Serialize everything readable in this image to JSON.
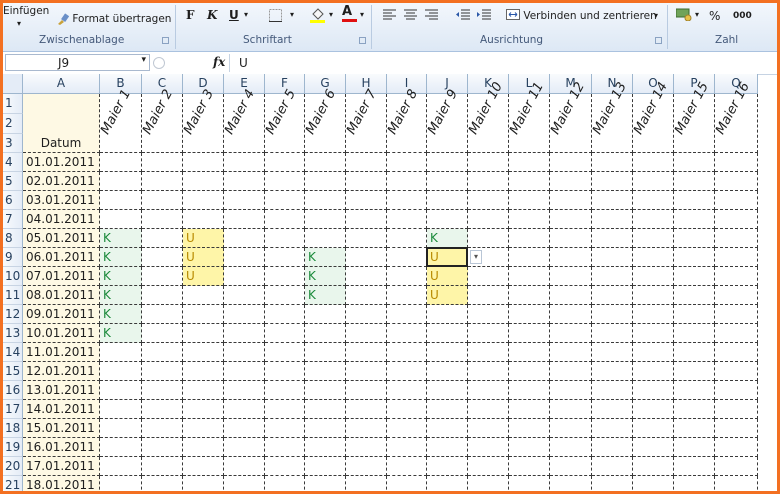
{
  "ribbon": {
    "paste_label": "Einfügen",
    "format_painter_label": "Format übertragen",
    "bold_label": "F",
    "italic_label": "K",
    "underline_label": "U",
    "font_color_letter": "A",
    "merge_label": "Verbinden und zentrieren",
    "percent_label": "%",
    "thousands_label": "000",
    "groups": [
      "Zwischenablage",
      "Schriftart",
      "Ausrichtung",
      "Zahl"
    ]
  },
  "formula_bar": {
    "name_box": "J9",
    "fx_label": "fx",
    "value": "U"
  },
  "grid": {
    "columns": [
      "A",
      "B",
      "C",
      "D",
      "E",
      "F",
      "G",
      "H",
      "I",
      "J",
      "K",
      "L",
      "M",
      "N",
      "O",
      "P",
      "Q"
    ],
    "header_rows": [
      "1",
      "2",
      "3"
    ],
    "date_header": "Datum",
    "employees": [
      "Maier 1",
      "Maier 2",
      "Maier 3",
      "Maier 4",
      "Maier 5",
      "Maier 6",
      "Maier 7",
      "Maier 8",
      "Maier 9",
      "Maier 10",
      "Maier 11",
      "Maier 12",
      "Maier 13",
      "Maier 14",
      "Maier 15",
      "Maier 16"
    ],
    "rows": [
      {
        "num": "4",
        "date": "01.01.2011",
        "cells": [
          "",
          "",
          "",
          "",
          "",
          "",
          "",
          "",
          "",
          "",
          "",
          "",
          "",
          "",
          "",
          ""
        ]
      },
      {
        "num": "5",
        "date": "02.01.2011",
        "cells": [
          "",
          "",
          "",
          "",
          "",
          "",
          "",
          "",
          "",
          "",
          "",
          "",
          "",
          "",
          "",
          ""
        ]
      },
      {
        "num": "6",
        "date": "03.01.2011",
        "cells": [
          "",
          "",
          "",
          "",
          "",
          "",
          "",
          "",
          "",
          "",
          "",
          "",
          "",
          "",
          "",
          ""
        ]
      },
      {
        "num": "7",
        "date": "04.01.2011",
        "cells": [
          "",
          "",
          "",
          "",
          "",
          "",
          "",
          "",
          "",
          "",
          "",
          "",
          "",
          "",
          "",
          ""
        ]
      },
      {
        "num": "8",
        "date": "05.01.2011",
        "cells": [
          "K",
          "",
          "U",
          "",
          "",
          "",
          "",
          "",
          "K",
          "",
          "",
          "",
          "",
          "",
          "",
          ""
        ]
      },
      {
        "num": "9",
        "date": "06.01.2011",
        "cells": [
          "K",
          "",
          "U",
          "",
          "",
          "K",
          "",
          "",
          "U",
          "",
          "",
          "",
          "",
          "",
          "",
          ""
        ]
      },
      {
        "num": "10",
        "date": "07.01.2011",
        "cells": [
          "K",
          "",
          "U",
          "",
          "",
          "K",
          "",
          "",
          "U",
          "",
          "",
          "",
          "",
          "",
          "",
          ""
        ]
      },
      {
        "num": "11",
        "date": "08.01.2011",
        "cells": [
          "K",
          "",
          "",
          "",
          "",
          "K",
          "",
          "",
          "U",
          "",
          "",
          "",
          "",
          "",
          "",
          ""
        ]
      },
      {
        "num": "12",
        "date": "09.01.2011",
        "cells": [
          "K",
          "",
          "",
          "",
          "",
          "",
          "",
          "",
          "",
          "",
          "",
          "",
          "",
          "",
          "",
          ""
        ]
      },
      {
        "num": "13",
        "date": "10.01.2011",
        "cells": [
          "K",
          "",
          "",
          "",
          "",
          "",
          "",
          "",
          "",
          "",
          "",
          "",
          "",
          "",
          "",
          ""
        ]
      },
      {
        "num": "14",
        "date": "11.01.2011",
        "cells": [
          "",
          "",
          "",
          "",
          "",
          "",
          "",
          "",
          "",
          "",
          "",
          "",
          "",
          "",
          "",
          ""
        ]
      },
      {
        "num": "15",
        "date": "12.01.2011",
        "cells": [
          "",
          "",
          "",
          "",
          "",
          "",
          "",
          "",
          "",
          "",
          "",
          "",
          "",
          "",
          "",
          ""
        ]
      },
      {
        "num": "16",
        "date": "13.01.2011",
        "cells": [
          "",
          "",
          "",
          "",
          "",
          "",
          "",
          "",
          "",
          "",
          "",
          "",
          "",
          "",
          "",
          ""
        ]
      },
      {
        "num": "17",
        "date": "14.01.2011",
        "cells": [
          "",
          "",
          "",
          "",
          "",
          "",
          "",
          "",
          "",
          "",
          "",
          "",
          "",
          "",
          "",
          ""
        ]
      },
      {
        "num": "18",
        "date": "15.01.2011",
        "cells": [
          "",
          "",
          "",
          "",
          "",
          "",
          "",
          "",
          "",
          "",
          "",
          "",
          "",
          "",
          "",
          ""
        ]
      },
      {
        "num": "19",
        "date": "16.01.2011",
        "cells": [
          "",
          "",
          "",
          "",
          "",
          "",
          "",
          "",
          "",
          "",
          "",
          "",
          "",
          "",
          "",
          ""
        ]
      },
      {
        "num": "20",
        "date": "17.01.2011",
        "cells": [
          "",
          "",
          "",
          "",
          "",
          "",
          "",
          "",
          "",
          "",
          "",
          "",
          "",
          "",
          "",
          ""
        ]
      },
      {
        "num": "21",
        "date": "18.01.2011",
        "cells": [
          "",
          "",
          "",
          "",
          "",
          "",
          "",
          "",
          "",
          "",
          "",
          "",
          "",
          "",
          "",
          ""
        ]
      }
    ]
  },
  "colors": {
    "frame": "#f37021",
    "k_fill": "#e9f6ec",
    "k_text": "#1a8a3a",
    "u_fill": "#fef5a8",
    "u_text": "#b88a00",
    "date_fill": "#fef9e4"
  }
}
